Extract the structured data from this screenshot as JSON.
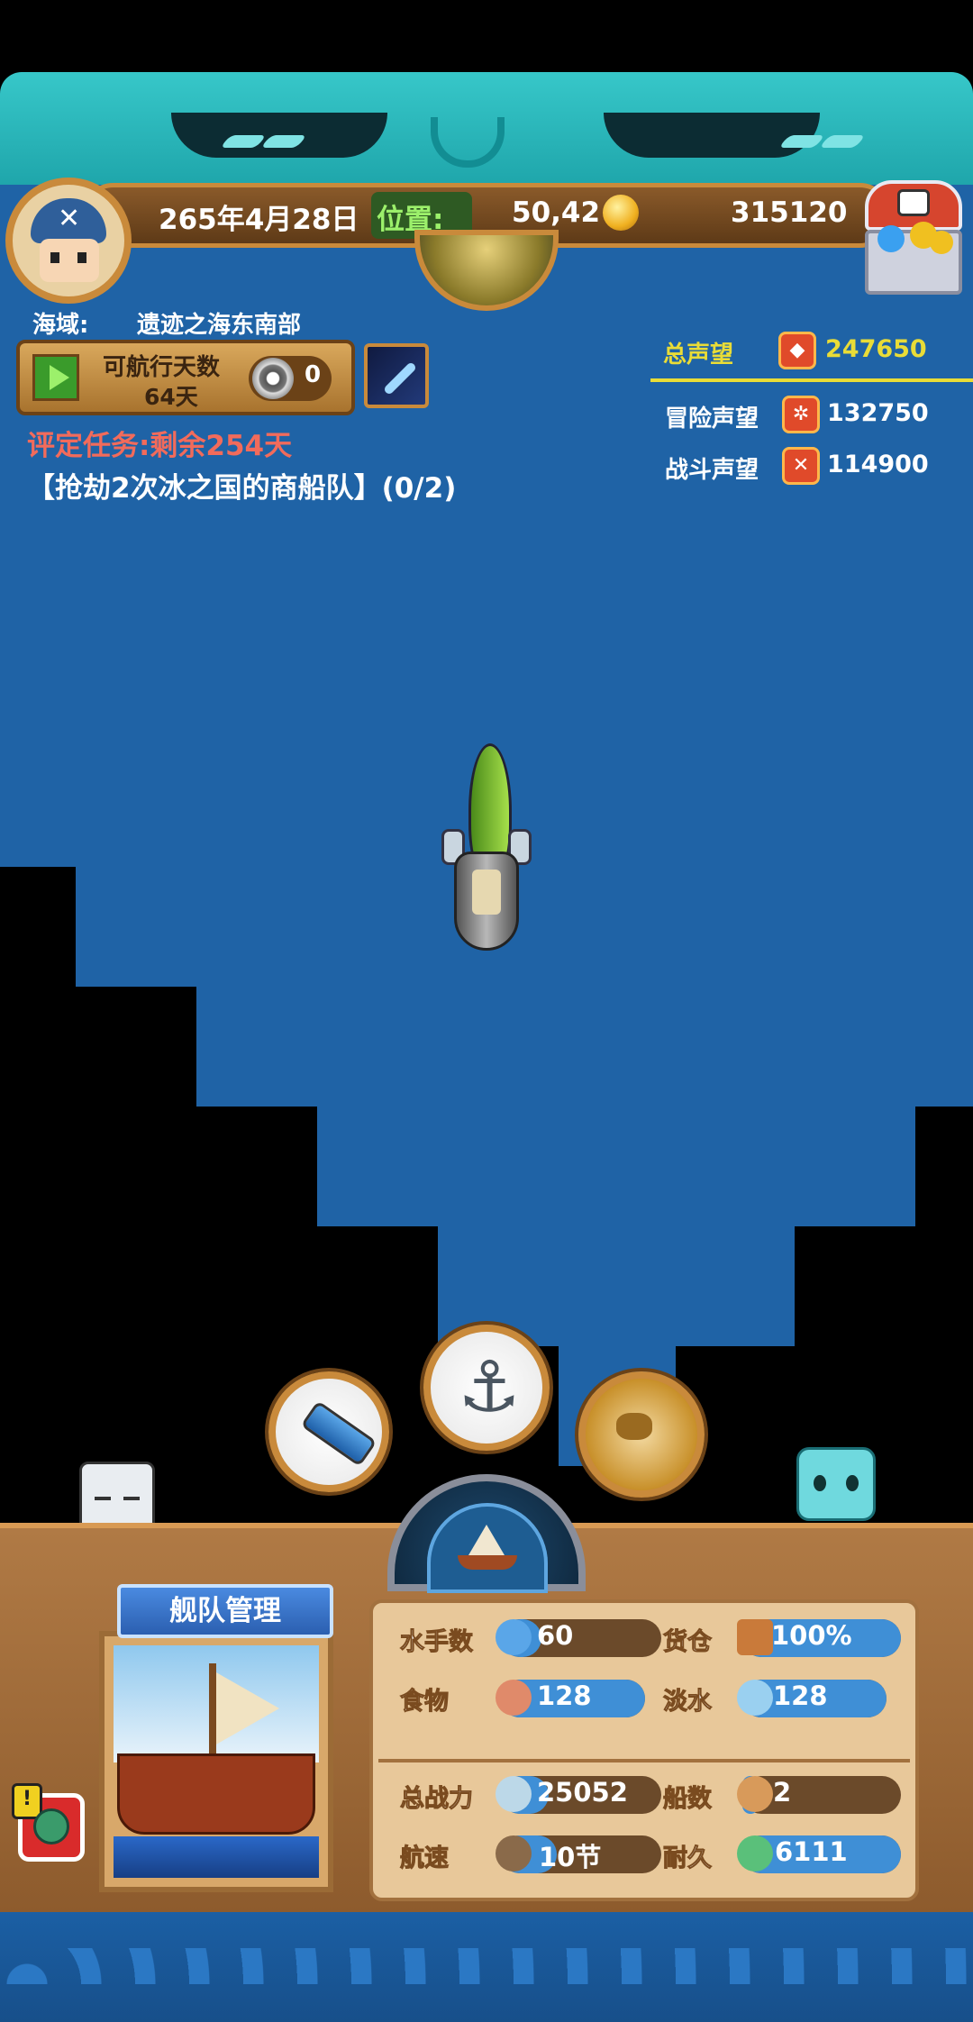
{
  "status_bar": {
    "date": "265年4月28日",
    "position_label": "位置:",
    "position_value": "50,42",
    "gold": "315120"
  },
  "sea_area": {
    "label": "海域:",
    "value": "遗迹之海东南部"
  },
  "sail_days": {
    "title": "可航行天数",
    "days": "64天",
    "counter": "0"
  },
  "mission": {
    "header": "评定任务:剩余254天",
    "text": "【抢劫2次冰之国的商船队】(0/2)"
  },
  "reputation": {
    "total_label": "总声望",
    "total_value": "247650",
    "adventure_label": "冒险声望",
    "adventure_value": "132750",
    "battle_label": "战斗声望",
    "battle_value": "114900"
  },
  "fleet": {
    "title": "舰队管理",
    "stats": {
      "sailors_label": "水手数",
      "sailors_value": "60",
      "sailors_fill": 0.25,
      "cargo_label": "货仓",
      "cargo_value": "100%",
      "cargo_fill": 1.0,
      "food_label": "食物",
      "food_value": "128",
      "food_fill": 1.0,
      "water_label": "淡水",
      "water_value": "128",
      "water_fill": 1.0,
      "power_label": "总战力",
      "power_value": "25052",
      "power_fill": 0.3,
      "ships_label": "船数",
      "ships_value": "2",
      "ships_fill": 0.1,
      "speed_label": "航速",
      "speed_value": "10节",
      "speed_fill": 0.35,
      "durability_label": "耐久",
      "durability_value": "6111",
      "durability_fill": 1.0
    }
  },
  "colors": {
    "sea": "#1f63a6",
    "reputation_total": "#e9dc37",
    "mission_header": "#f26b5b",
    "bar_fill": "#3f8fd6"
  }
}
